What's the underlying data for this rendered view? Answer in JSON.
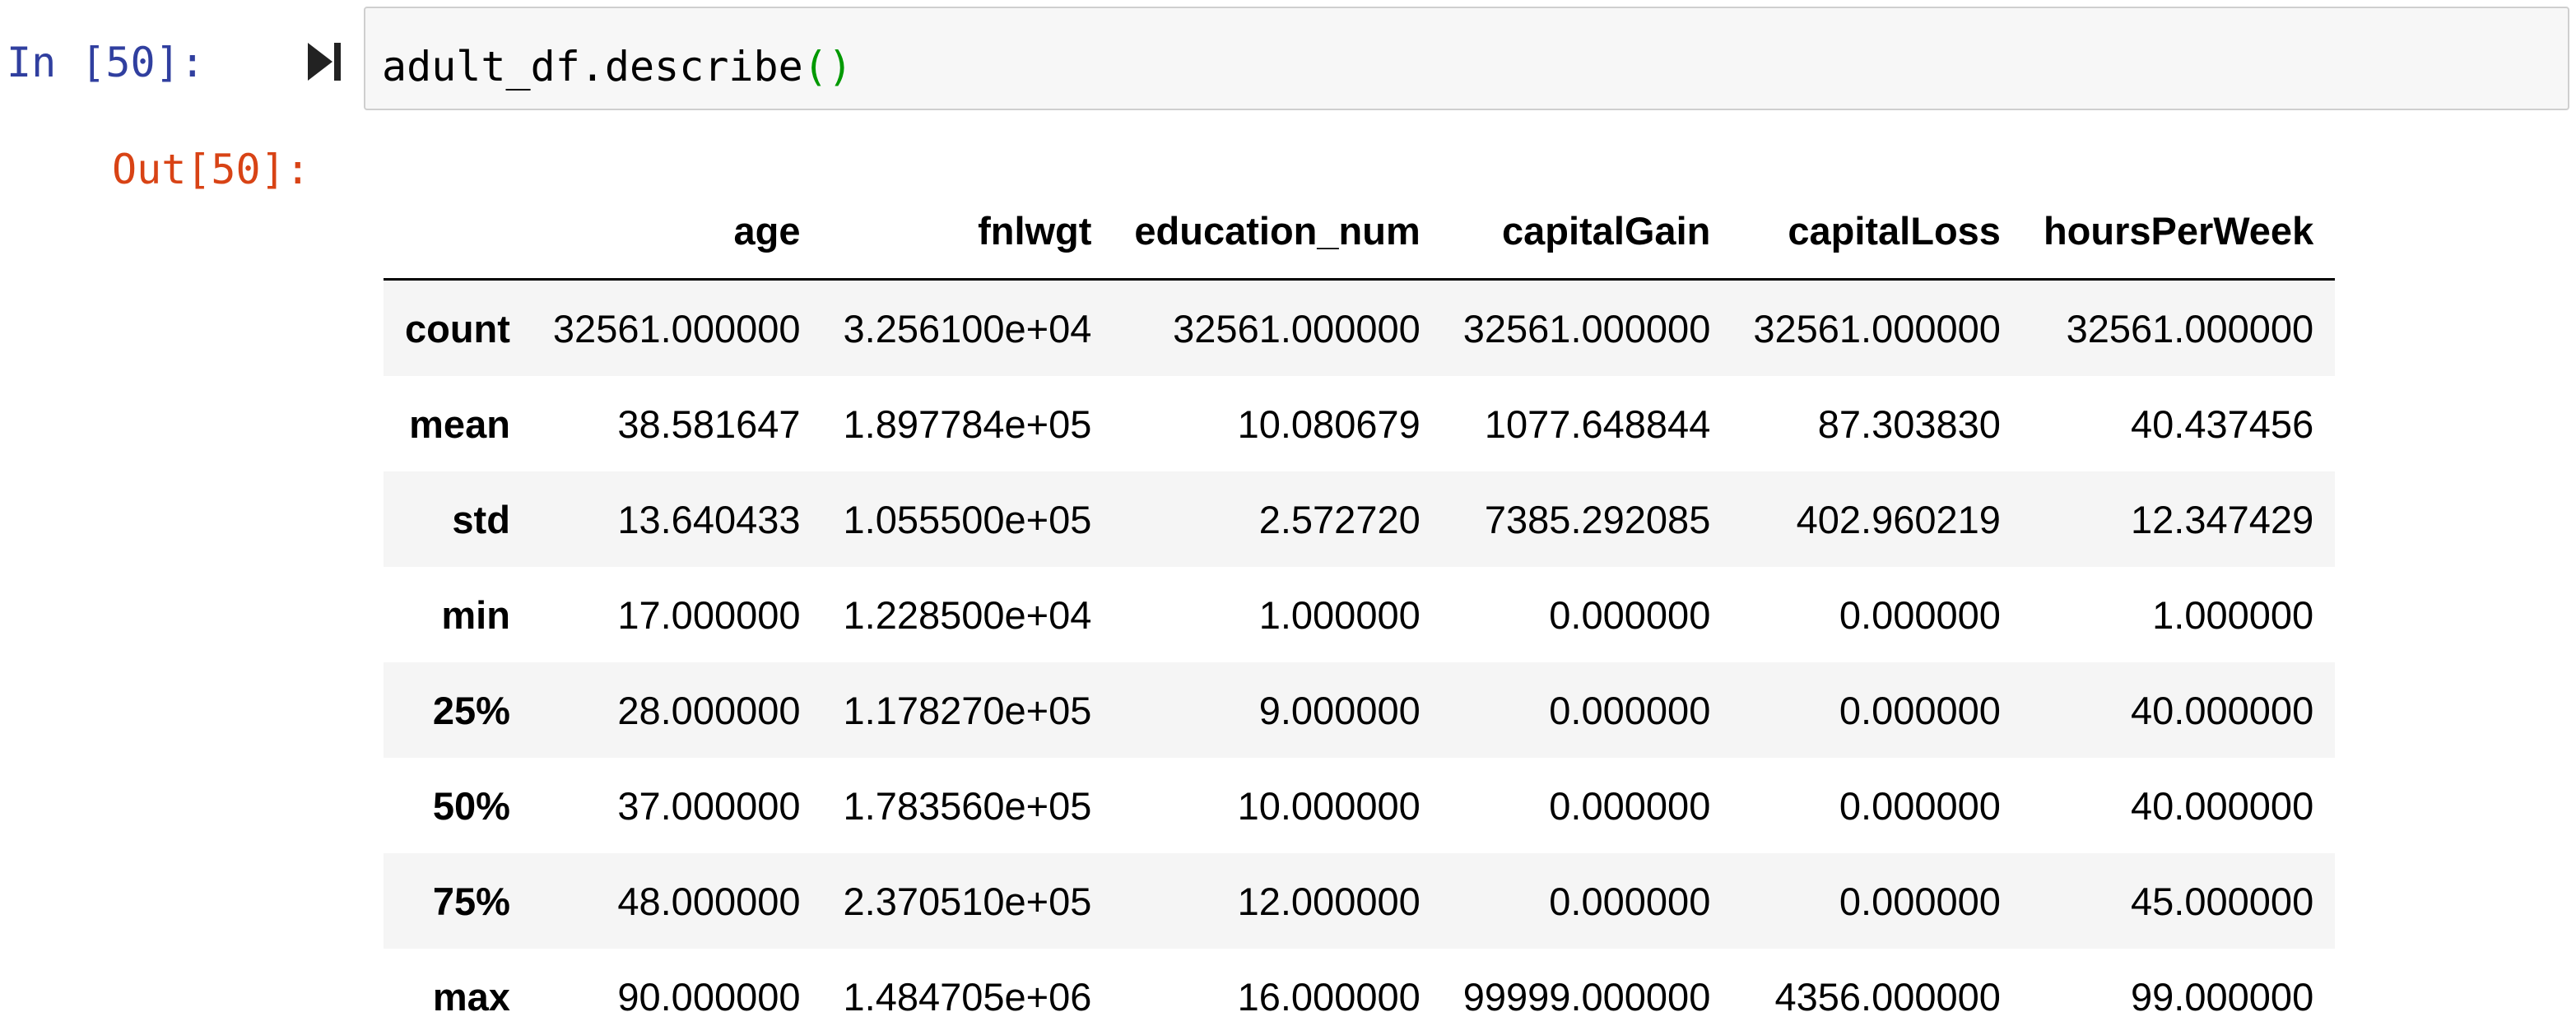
{
  "cell": {
    "in_prompt": "In [50]:",
    "out_prompt": "Out[50]:",
    "code_main": "adult_df.describe",
    "code_parens": "()"
  },
  "table": {
    "columns": [
      "age",
      "fnlwgt",
      "education_num",
      "capitalGain",
      "capitalLoss",
      "hoursPerWeek"
    ],
    "rows": [
      {
        "label": "count",
        "values": [
          "32561.000000",
          "3.256100e+04",
          "32561.000000",
          "32561.000000",
          "32561.000000",
          "32561.000000"
        ]
      },
      {
        "label": "mean",
        "values": [
          "38.581647",
          "1.897784e+05",
          "10.080679",
          "1077.648844",
          "87.303830",
          "40.437456"
        ]
      },
      {
        "label": "std",
        "values": [
          "13.640433",
          "1.055500e+05",
          "2.572720",
          "7385.292085",
          "402.960219",
          "12.347429"
        ]
      },
      {
        "label": "min",
        "values": [
          "17.000000",
          "1.228500e+04",
          "1.000000",
          "0.000000",
          "0.000000",
          "1.000000"
        ]
      },
      {
        "label": "25%",
        "values": [
          "28.000000",
          "1.178270e+05",
          "9.000000",
          "0.000000",
          "0.000000",
          "40.000000"
        ]
      },
      {
        "label": "50%",
        "values": [
          "37.000000",
          "1.783560e+05",
          "10.000000",
          "0.000000",
          "0.000000",
          "40.000000"
        ]
      },
      {
        "label": "75%",
        "values": [
          "48.000000",
          "2.370510e+05",
          "12.000000",
          "0.000000",
          "0.000000",
          "45.000000"
        ]
      },
      {
        "label": "max",
        "values": [
          "90.000000",
          "1.484705e+06",
          "16.000000",
          "99999.000000",
          "4356.000000",
          "99.000000"
        ]
      }
    ]
  },
  "icons": {
    "run": "step-forward-icon"
  },
  "colors": {
    "in_prompt": "#303f9f",
    "out_prompt": "#d84315",
    "code_paren": "#009900",
    "input_bg": "#f7f7f7",
    "row_stripe": "#f5f5f5"
  }
}
